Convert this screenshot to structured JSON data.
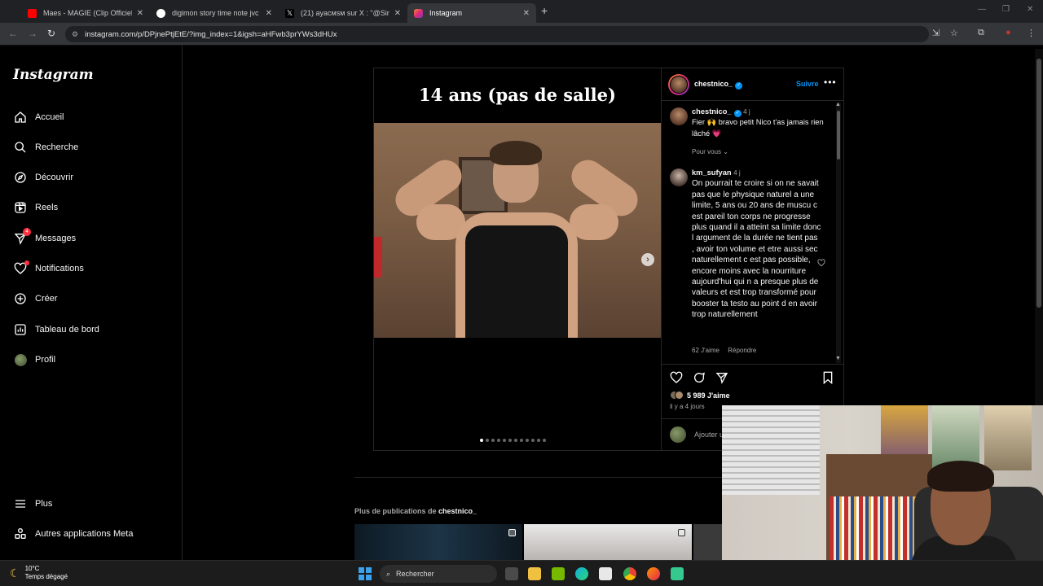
{
  "browser": {
    "tabs": [
      {
        "title": "Maes - MAGIE (Clip Officiel) - Yo",
        "favicon_color": "#ff0000",
        "icon": "youtube-icon"
      },
      {
        "title": "digimon story time note jvc - Re",
        "favicon_color": "#ffffff",
        "icon": "google-icon"
      },
      {
        "title": "(21) ayacмsм sur X : \"@SindyOf",
        "favicon_color": "#000000",
        "icon": "x-icon"
      },
      {
        "title": "Instagram",
        "favicon_color": "#e1306c",
        "icon": "instagram-icon",
        "active": true
      }
    ],
    "url": "instagram.com/p/DPjnePtjEtE/?img_index=1&igsh=aHFwb3prYWs3dHUx"
  },
  "sidebar": {
    "logo": "Instagram",
    "items": [
      {
        "label": "Accueil",
        "icon": "home-icon"
      },
      {
        "label": "Recherche",
        "icon": "search-icon"
      },
      {
        "label": "Découvrir",
        "icon": "compass-icon"
      },
      {
        "label": "Reels",
        "icon": "reels-icon"
      },
      {
        "label": "Messages",
        "icon": "messenger-icon",
        "badge": "4"
      },
      {
        "label": "Notifications",
        "icon": "heart-icon",
        "dot": true
      },
      {
        "label": "Créer",
        "icon": "plus-square-icon"
      },
      {
        "label": "Tableau de bord",
        "icon": "chart-icon"
      },
      {
        "label": "Profil",
        "icon": "avatar-icon"
      }
    ],
    "bottom": [
      {
        "label": "Plus",
        "icon": "menu-icon"
      },
      {
        "label": "Autres applications Meta",
        "icon": "meta-apps-icon"
      }
    ]
  },
  "post": {
    "media_caption": "14 ans (pas de salle)",
    "slide_count": 12,
    "current_slide": 1,
    "author": "chestnico_",
    "follow_label": "Suivre",
    "caption": {
      "user": "chestnico_",
      "age": "4 j",
      "text": "Fier 🙌 bravo petit Nico t'as jamais rien lâché 💗",
      "toggle": "Pour vous"
    },
    "comment": {
      "user": "km_sufyan",
      "age": "4 j",
      "text": "On pourrait te croire si on ne savait pas que le physique naturel a une limite, 5 ans ou 20 ans de muscu c est pareil ton corps ne progresse plus quand il a atteint sa limite donc l argument de la durée ne tient pas , avoir ton volume et etre aussi sec naturellement c est pas possible, encore moins avec la nourriture aujourd'hui qui n a presque plus de valeurs et est trop transformé pour booster ta testo au point d en avoir trop naturellement",
      "likes": "62 J'aime",
      "reply": "Répondre"
    },
    "likes": "5 989 J'aime",
    "time_ago": "il y a 4 jours",
    "add_comment_placeholder": "Ajouter un commentaire…"
  },
  "more_posts": {
    "prefix": "Plus de publications de",
    "user": "chestnico_"
  },
  "taskbar": {
    "temperature": "10°C",
    "weather": "Temps dégagé",
    "search_placeholder": "Rechercher"
  }
}
